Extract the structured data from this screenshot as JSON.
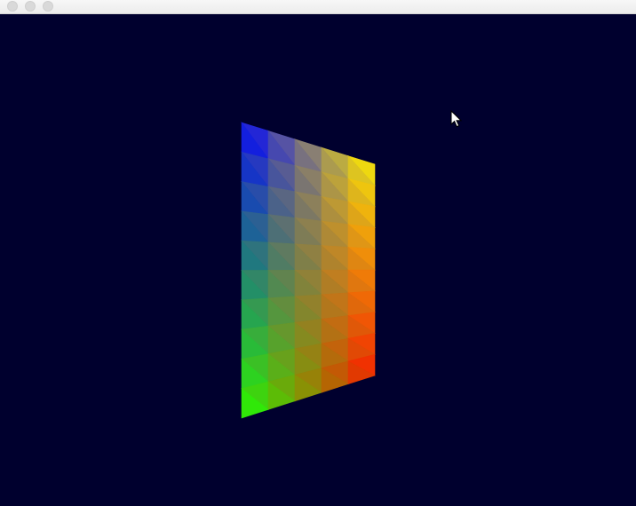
{
  "window": {
    "buttons": [
      "close",
      "minimize",
      "zoom"
    ]
  },
  "scene": {
    "background_color": "#00002e",
    "mesh": {
      "rows": 10,
      "cols": 5,
      "corner_colors": {
        "top_left": "#0000ff",
        "top_right": "#ffee00",
        "bottom_left": "#22ff00",
        "bottom_right": "#ff1500"
      }
    }
  },
  "cursor": {
    "icon": "arrow-pointer-icon"
  }
}
